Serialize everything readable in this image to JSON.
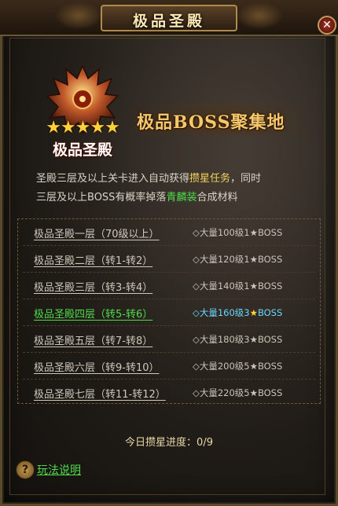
{
  "window": {
    "title": "极品圣殿"
  },
  "emblem": {
    "stars": "★★★★★",
    "label": "极品圣殿"
  },
  "banner": {
    "text": "极品BOSS聚集地"
  },
  "description": {
    "line1_a": "圣殿三层及以上关卡进入自动获得",
    "line1_hl": "攒星任务",
    "line1_b": "，同时",
    "line2_a": "三层及以上BOSS有概率掉落",
    "line2_hl": "青麟装",
    "line2_b": "合成材料"
  },
  "stages": [
    {
      "name": "极品圣殿一层（70级以上）",
      "reward_a": "◇大量100级1",
      "star": "★",
      "reward_b": "BOSS",
      "active": false
    },
    {
      "name": "极品圣殿二层（转1-转2）",
      "reward_a": "◇大量120级1",
      "star": "★",
      "reward_b": "BOSS",
      "active": false
    },
    {
      "name": "极品圣殿三层（转3-转4）",
      "reward_a": "◇大量140级1",
      "star": "★",
      "reward_b": "BOSS",
      "active": false
    },
    {
      "name": "极品圣殿四层（转5-转6）",
      "reward_a": "◇大量160级3",
      "star": "★",
      "reward_b": "BOSS",
      "active": true
    },
    {
      "name": "极品圣殿五层（转7-转8）",
      "reward_a": "◇大量180级3",
      "star": "★",
      "reward_b": "BOSS",
      "active": false
    },
    {
      "name": "极品圣殿六层（转9-转10）",
      "reward_a": "◇大量200级5",
      "star": "★",
      "reward_b": "BOSS",
      "active": false
    },
    {
      "name": "极品圣殿七层（转11-转12）",
      "reward_a": "◇大量220级5",
      "star": "★",
      "reward_b": "BOSS",
      "active": false
    }
  ],
  "progress": {
    "label": "今日攒星进度：",
    "value": "0/9"
  },
  "help": {
    "icon": "?",
    "label": "玩法说明"
  },
  "colors": {
    "accent_green": "#4fdc4a",
    "accent_yellow": "#f3d35a",
    "active_blue": "#69d7ff"
  }
}
